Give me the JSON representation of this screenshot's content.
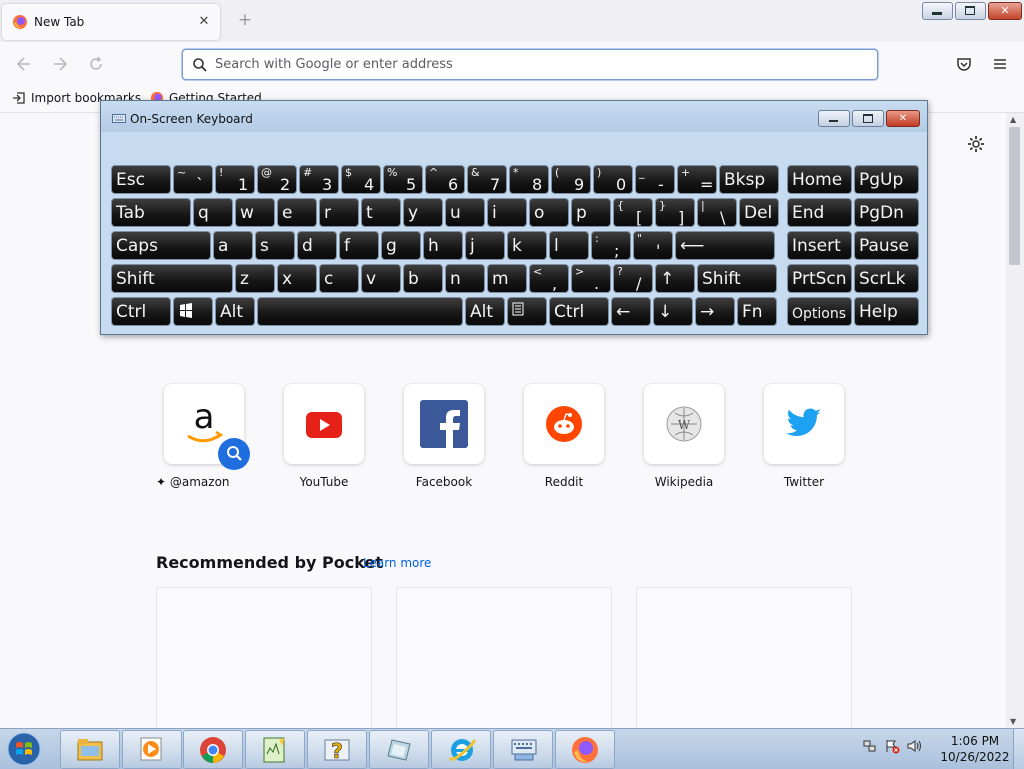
{
  "browser": {
    "tab": {
      "title": "New Tab"
    },
    "new_tab_glyph": "+",
    "url_placeholder": "Search with Google or enter address",
    "bookmarks": [
      {
        "label": "Import bookmarks...",
        "icon": "import-icon"
      },
      {
        "label": "Getting Started",
        "icon": "firefox-icon"
      }
    ]
  },
  "osk": {
    "title": "On-Screen Keyboard",
    "rows": [
      [
        {
          "k": "Esc"
        },
        {
          "s": "~",
          "m": "`"
        },
        {
          "s": "!",
          "m": "1"
        },
        {
          "s": "@",
          "m": "2"
        },
        {
          "s": "#",
          "m": "3"
        },
        {
          "s": "$",
          "m": "4"
        },
        {
          "s": "%",
          "m": "5"
        },
        {
          "s": "^",
          "m": "6"
        },
        {
          "s": "&",
          "m": "7"
        },
        {
          "s": "*",
          "m": "8"
        },
        {
          "s": "(",
          "m": "9"
        },
        {
          "s": ")",
          "m": "0"
        },
        {
          "s": "_",
          "m": "-"
        },
        {
          "s": "+",
          "m": "="
        },
        {
          "k": "Bksp"
        },
        {
          "k": "Home"
        },
        {
          "k": "PgUp"
        }
      ],
      [
        {
          "k": "Tab"
        },
        {
          "k": "q"
        },
        {
          "k": "w"
        },
        {
          "k": "e"
        },
        {
          "k": "r"
        },
        {
          "k": "t"
        },
        {
          "k": "y"
        },
        {
          "k": "u"
        },
        {
          "k": "i"
        },
        {
          "k": "o"
        },
        {
          "k": "p"
        },
        {
          "s": "{",
          "m": "["
        },
        {
          "s": "}",
          "m": "]"
        },
        {
          "s": "|",
          "m": "\\"
        },
        {
          "k": "Del"
        },
        {
          "k": "End"
        },
        {
          "k": "PgDn"
        }
      ],
      [
        {
          "k": "Caps"
        },
        {
          "k": "a"
        },
        {
          "k": "s"
        },
        {
          "k": "d"
        },
        {
          "k": "f"
        },
        {
          "k": "g"
        },
        {
          "k": "h"
        },
        {
          "k": "j"
        },
        {
          "k": "k"
        },
        {
          "k": "l"
        },
        {
          "s": ":",
          "m": ";"
        },
        {
          "s": "\"",
          "m": "'"
        },
        {
          "k": "⟵"
        },
        {
          "k": "Insert"
        },
        {
          "k": "Pause"
        }
      ],
      [
        {
          "k": "Shift"
        },
        {
          "k": "z"
        },
        {
          "k": "x"
        },
        {
          "k": "c"
        },
        {
          "k": "v"
        },
        {
          "k": "b"
        },
        {
          "k": "n"
        },
        {
          "k": "m"
        },
        {
          "s": "<",
          "m": ","
        },
        {
          "s": ">",
          "m": "."
        },
        {
          "s": "?",
          "m": "/"
        },
        {
          "k": "↑"
        },
        {
          "k": "Shift"
        },
        {
          "k": "PrtScn"
        },
        {
          "k": "ScrLk"
        }
      ],
      [
        {
          "k": "Ctrl"
        },
        {
          "k": "",
          "icon": "windows-key"
        },
        {
          "k": "Alt"
        },
        {
          "k": ""
        },
        {
          "k": "Alt"
        },
        {
          "k": "",
          "icon": "menu-key"
        },
        {
          "k": "Ctrl"
        },
        {
          "k": "←"
        },
        {
          "k": "↓"
        },
        {
          "k": "→"
        },
        {
          "k": "Fn"
        },
        {
          "k": "Options"
        },
        {
          "k": "Help"
        }
      ]
    ]
  },
  "top_sites": [
    {
      "label": "@amazon",
      "icon": "amazon-icon",
      "pinned": true
    },
    {
      "label": "YouTube",
      "icon": "youtube-icon"
    },
    {
      "label": "Facebook",
      "icon": "facebook-icon"
    },
    {
      "label": "Reddit",
      "icon": "reddit-icon"
    },
    {
      "label": "Wikipedia",
      "icon": "wikipedia-icon"
    },
    {
      "label": "Twitter",
      "icon": "twitter-icon"
    }
  ],
  "pocket": {
    "title": "Recommended by Pocket",
    "learn_more": "Learn more"
  },
  "taskbar": {
    "apps": [
      "explorer-icon",
      "media-player-icon",
      "chrome-icon",
      "notepad-icon",
      "help-icon",
      "tablet-icon",
      "ie-icon",
      "osk-icon",
      "firefox-icon"
    ],
    "time": "1:06 PM",
    "date": "10/26/2022"
  },
  "colors": {
    "urlbar_focus": "#7a9bd4",
    "pocket_link": "#0060df",
    "osk_key": "#151515",
    "taskbar": "#b9cce3"
  }
}
